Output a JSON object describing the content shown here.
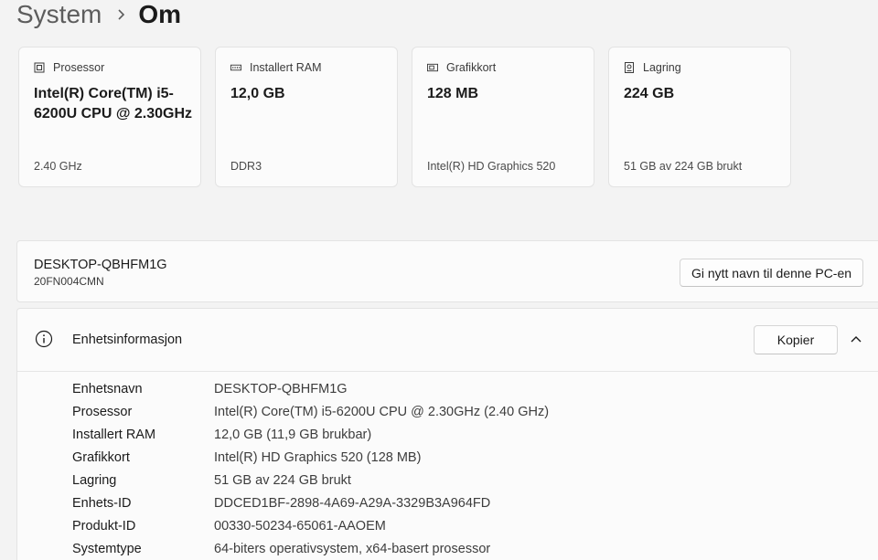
{
  "breadcrumb": {
    "parent": "System",
    "current": "Om"
  },
  "cards": [
    {
      "icon": "processor-icon",
      "label": "Prosessor",
      "value": "Intel(R) Core(TM) i5-6200U CPU @ 2.30GHz",
      "sub": "2.40 GHz"
    },
    {
      "icon": "ram-icon",
      "label": "Installert RAM",
      "value": "12,0 GB",
      "sub": "DDR3"
    },
    {
      "icon": "graphics-card-icon",
      "label": "Grafikkort",
      "value": "128 MB",
      "sub": "Intel(R) HD Graphics 520"
    },
    {
      "icon": "storage-icon",
      "label": "Lagring",
      "value": "224 GB",
      "sub": "51 GB av 224 GB brukt"
    }
  ],
  "device": {
    "name": "DESKTOP-QBHFM1G",
    "model": "20FN004CMN",
    "rename_label": "Gi nytt navn til denne PC-en"
  },
  "device_info": {
    "title": "Enhetsinformasjon",
    "copy_label": "Kopier",
    "rows": [
      {
        "label": "Enhetsnavn",
        "value": "DESKTOP-QBHFM1G"
      },
      {
        "label": "Prosessor",
        "value": "Intel(R) Core(TM) i5-6200U CPU @ 2.30GHz (2.40 GHz)"
      },
      {
        "label": "Installert RAM",
        "value": "12,0 GB (11,9 GB brukbar)"
      },
      {
        "label": "Grafikkort",
        "value": "Intel(R) HD Graphics 520 (128 MB)"
      },
      {
        "label": "Lagring",
        "value": "51 GB av 224 GB brukt"
      },
      {
        "label": "Enhets-ID",
        "value": "DDCED1BF-2898-4A69-A29A-3329B3A964FD"
      },
      {
        "label": "Produkt-ID",
        "value": "00330-50234-65061-AAOEM"
      },
      {
        "label": "Systemtype",
        "value": "64-biters operativsystem, x64-basert prosessor"
      }
    ]
  }
}
